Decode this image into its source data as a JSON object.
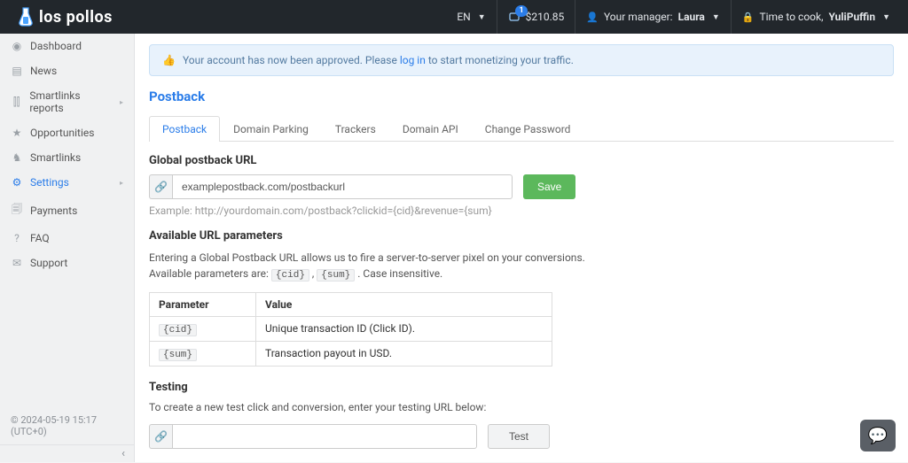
{
  "brand": "los pollos",
  "nav": {
    "language": "EN",
    "balance": "$210.85",
    "notif_count": "1",
    "manager_label": "Your manager:",
    "manager_name": "Laura",
    "cook_label": "Time to cook,",
    "username": "YuliPuffin"
  },
  "sidebar": {
    "items": [
      {
        "icon": "◉",
        "label": "Dashboard",
        "has_sub": false
      },
      {
        "icon": "▤",
        "label": "News",
        "has_sub": false
      },
      {
        "icon": "⫿⫿",
        "label": "Smartlinks reports",
        "has_sub": true
      },
      {
        "icon": "★",
        "label": "Opportunities",
        "has_sub": false
      },
      {
        "icon": "♞",
        "label": "Smartlinks",
        "has_sub": false
      },
      {
        "icon": "⚙",
        "label": "Settings",
        "has_sub": true
      },
      {
        "icon": "🗐",
        "label": "Payments",
        "has_sub": false
      },
      {
        "icon": "?",
        "label": "FAQ",
        "has_sub": false
      },
      {
        "icon": "✉",
        "label": "Support",
        "has_sub": false
      }
    ],
    "footer_time": "© 2024-05-19 15:17 (UTC+0)"
  },
  "alert": {
    "prefix": "Your account has now been approved. Please ",
    "link": "log in",
    "suffix": " to start monetizing your traffic."
  },
  "page_title": "Postback",
  "tabs": [
    "Postback",
    "Domain Parking",
    "Trackers",
    "Domain API",
    "Change Password"
  ],
  "postback": {
    "url_heading": "Global postback URL",
    "url_value": "examplepostback.com/postbackurl",
    "save_label": "Save",
    "example_text": "Example: http://yourdomain.com/postback?clickid={cid}&revenue={sum}",
    "avail_heading": "Available URL parameters",
    "desc_line1": "Entering a Global Postback URL allows us to fire a server-to-server pixel on your conversions.",
    "desc_line2a": "Available parameters are: ",
    "desc_line2b": " . Case insensitive.",
    "param1_code": "{cid}",
    "param2_code": "{sum}",
    "table": {
      "h1": "Parameter",
      "h2": "Value",
      "rows": [
        {
          "p": "{cid}",
          "v": "Unique transaction ID (Click ID)."
        },
        {
          "p": "{sum}",
          "v": "Transaction payout in USD."
        }
      ]
    },
    "testing_heading": "Testing",
    "testing_desc": "To create a new test click and conversion, enter your testing URL below:",
    "test_label": "Test"
  }
}
